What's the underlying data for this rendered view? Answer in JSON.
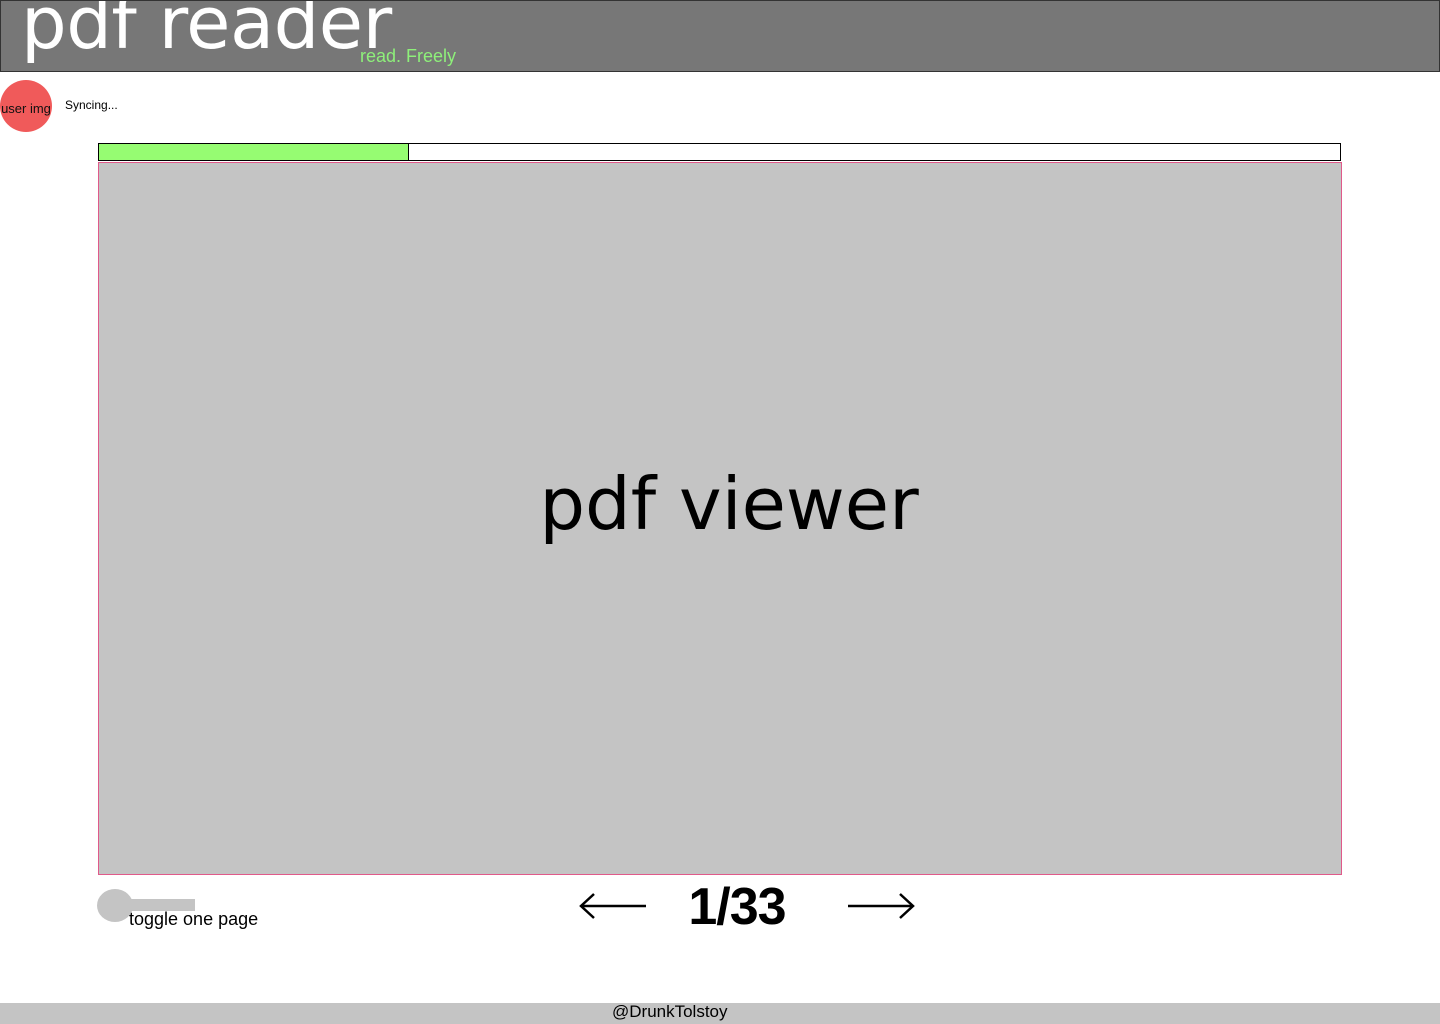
{
  "header": {
    "title": "pdf reader",
    "tagline": "read. Freely"
  },
  "user": {
    "avatar_label": "user img",
    "sync_status": "Syncing..."
  },
  "progress": {
    "fraction": 0.25
  },
  "viewer": {
    "label": "pdf viewer"
  },
  "toggle": {
    "label": "toggle one page",
    "enabled": false
  },
  "pagination": {
    "current_page": 1,
    "total_pages": 33,
    "display": "1/33",
    "prev_icon": "arrow-left-icon",
    "next_icon": "arrow-right-icon"
  },
  "footer": {
    "credit": "@DrunkTolstoy"
  },
  "colors": {
    "header_bg": "#777777",
    "tagline": "#8ef07a",
    "avatar": "#f05a5a",
    "progress_fill": "#96fc72",
    "viewer_bg": "#c4c4c4",
    "viewer_border": "#e05a8a",
    "footer_bg": "#c4c4c4"
  }
}
